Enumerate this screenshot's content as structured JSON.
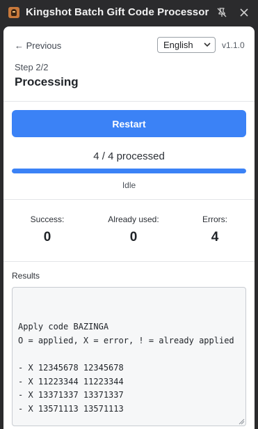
{
  "window": {
    "title": "Kingshot Batch Gift Code Processor",
    "icons": [
      "app-icon",
      "pin-off-icon",
      "close-icon"
    ]
  },
  "header": {
    "previous_label": "← Previous",
    "language_selected": "English",
    "version": "v1.1.0",
    "step": "Step 2/2",
    "heading": "Processing"
  },
  "actions": {
    "restart_label": "Restart"
  },
  "progress": {
    "text": "4 / 4 processed",
    "fraction": 1.0,
    "status": "Idle",
    "color": "#3b82f6"
  },
  "stats": [
    {
      "label": "Success:",
      "value": "0"
    },
    {
      "label": "Already used:",
      "value": "0"
    },
    {
      "label": "Errors:",
      "value": "4"
    }
  ],
  "results": {
    "label": "Results",
    "lines": [
      "Apply code BAZINGA",
      "O = applied, X = error, ! = already applied",
      "",
      "- X 12345678 12345678",
      "- X 11223344 11223344",
      "- X 13371337 13371337",
      "- X 13571113 13571113"
    ]
  }
}
